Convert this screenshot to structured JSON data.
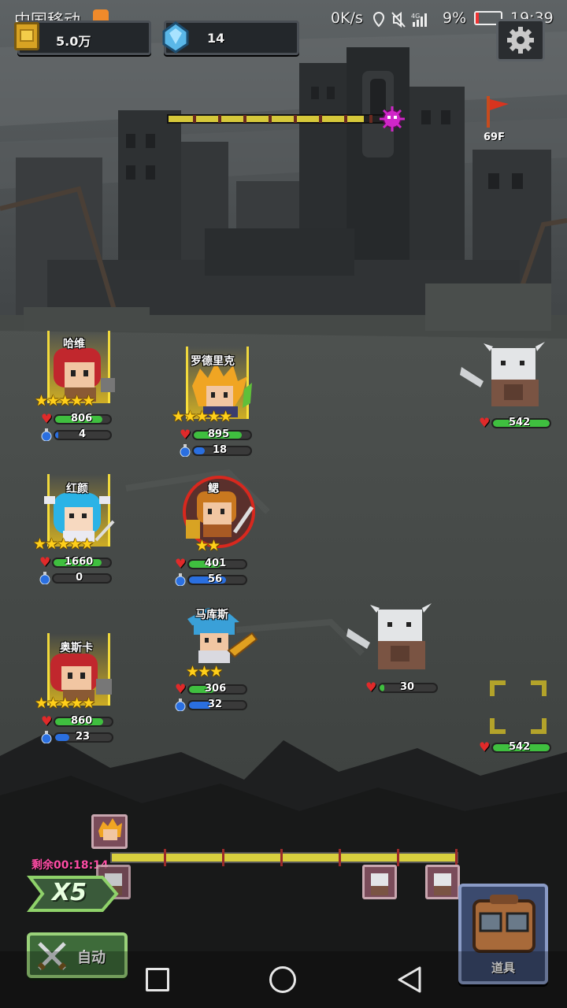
{
  "status_bar": {
    "carrier": "中国移动",
    "net_speed": "0K/s",
    "battery": "9%",
    "time": "19:39"
  },
  "resources": {
    "gold": "5.0万",
    "gems": "14"
  },
  "stage": {
    "floor": "69F",
    "progress": 0.9
  },
  "heroes": [
    {
      "name": "哈维",
      "hp": "806",
      "mp": "4",
      "stars": 5,
      "hp_pct": 0.85,
      "mp_pct": 0.05
    },
    {
      "name": "罗德里克",
      "hp": "895",
      "mp": "18",
      "stars": 5,
      "hp_pct": 0.85,
      "mp_pct": 0.2
    },
    {
      "name": "红颜",
      "hp": "1660",
      "mp": "0",
      "stars": 5,
      "hp_pct": 0.85,
      "mp_pct": 0.0
    },
    {
      "name": "鳃",
      "hp": "401",
      "mp": "56",
      "stars": 2,
      "hp_pct": 0.55,
      "mp_pct": 0.65
    },
    {
      "name": "马库斯",
      "hp": "306",
      "mp": "32",
      "stars": 3,
      "hp_pct": 0.45,
      "mp_pct": 0.4
    },
    {
      "name": "奥斯卡",
      "hp": "860",
      "mp": "23",
      "stars": 5,
      "hp_pct": 0.85,
      "mp_pct": 0.25
    }
  ],
  "enemies": [
    {
      "hp": "542",
      "hp_pct": 1.0
    },
    {
      "hp": "30",
      "hp_pct": 0.08
    },
    {
      "hp": "542",
      "hp_pct": 1.0
    }
  ],
  "battle": {
    "time_remaining": "剩余00:18:14",
    "speed": "X5",
    "auto_label": "自动",
    "items_label": "道具",
    "timeline_progress": 1.0
  },
  "colors": {
    "accent_gold": "#ffcf1a",
    "hp_green": "#3fbf3f",
    "mp_blue": "#2a6fe0",
    "boss_marker": "#d026c8",
    "timer_text": "#ff4da6"
  },
  "nav": {
    "recent": "square",
    "home": "circle",
    "back": "triangle"
  }
}
